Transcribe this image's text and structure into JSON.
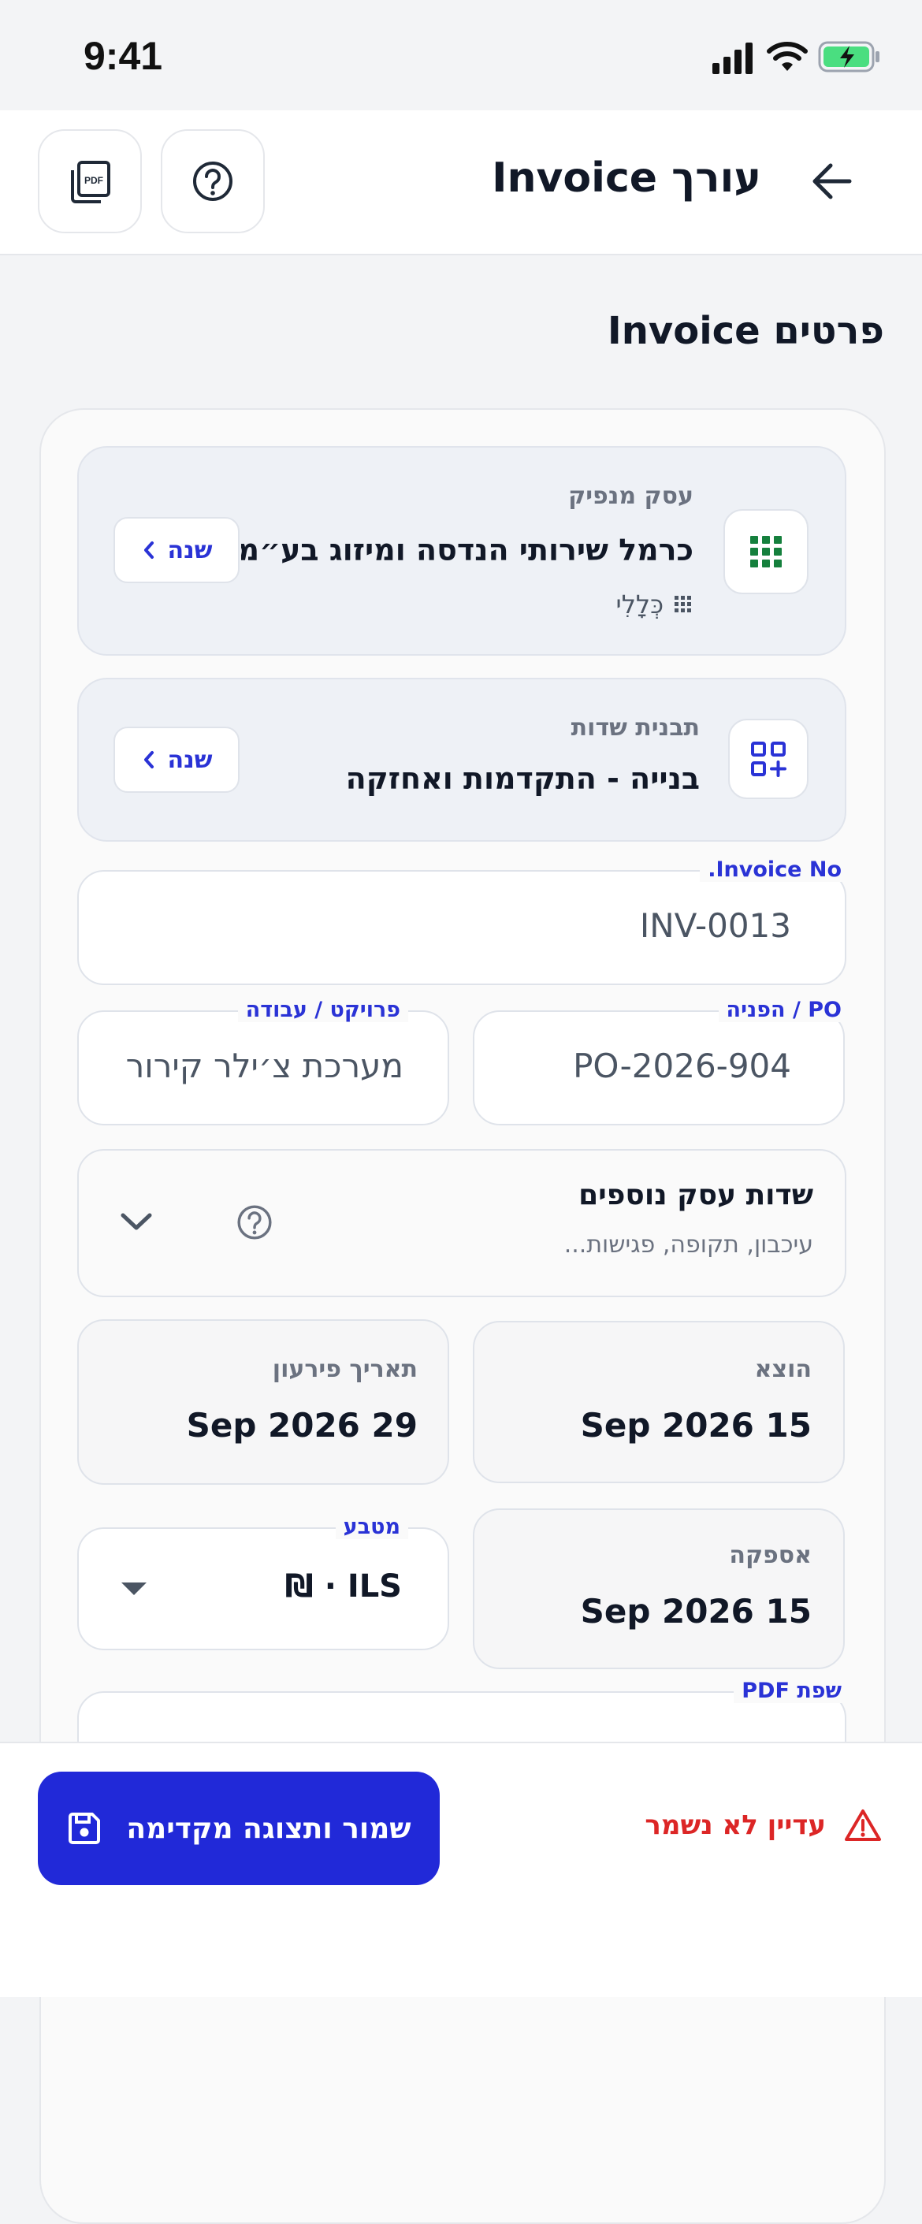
{
  "status_bar": {
    "time": "9:41"
  },
  "header": {
    "title": "עורך Invoice"
  },
  "section": {
    "title": "פרטים Invoice"
  },
  "issuer": {
    "label": "עסק מנפיק",
    "name": "כרמל שירותי הנדסה ומיזוג בע״מ",
    "category": "כְּלָלִי",
    "change_label": "שנה"
  },
  "template": {
    "label": "תבנית שדות",
    "name": "בנייה - התקדמות ואחזקה",
    "change_label": "שנה"
  },
  "invoice_no": {
    "label": "Invoice No.",
    "value": "INV-0013"
  },
  "po": {
    "label": "PO / הפניה",
    "value": "PO-2026-904"
  },
  "project": {
    "label": "פרויקט / עבודה",
    "value": "מערכת צ׳ילר קירור :"
  },
  "extra_fields": {
    "title": "שדות עסק נוספים",
    "subtitle": "עיכבון, תקופה, פגישות..."
  },
  "issued": {
    "label": "הוצא",
    "value": "15 Sep 2026"
  },
  "due": {
    "label": "תאריך פירעון",
    "value": "29 Sep 2026"
  },
  "supply": {
    "label": "אספקה",
    "value": "15 Sep 2026"
  },
  "currency": {
    "label": "מטבע",
    "value": "ILS · ₪"
  },
  "pdf_lang": {
    "label": "שפת PDF"
  },
  "footer": {
    "save_label": "שמור ותצוגה מקדימה",
    "unsaved_label": "עדיין לא נשמר"
  },
  "colors": {
    "accent": "#2129d8",
    "danger": "#dc2626",
    "issuer_icon": "#15803d"
  }
}
